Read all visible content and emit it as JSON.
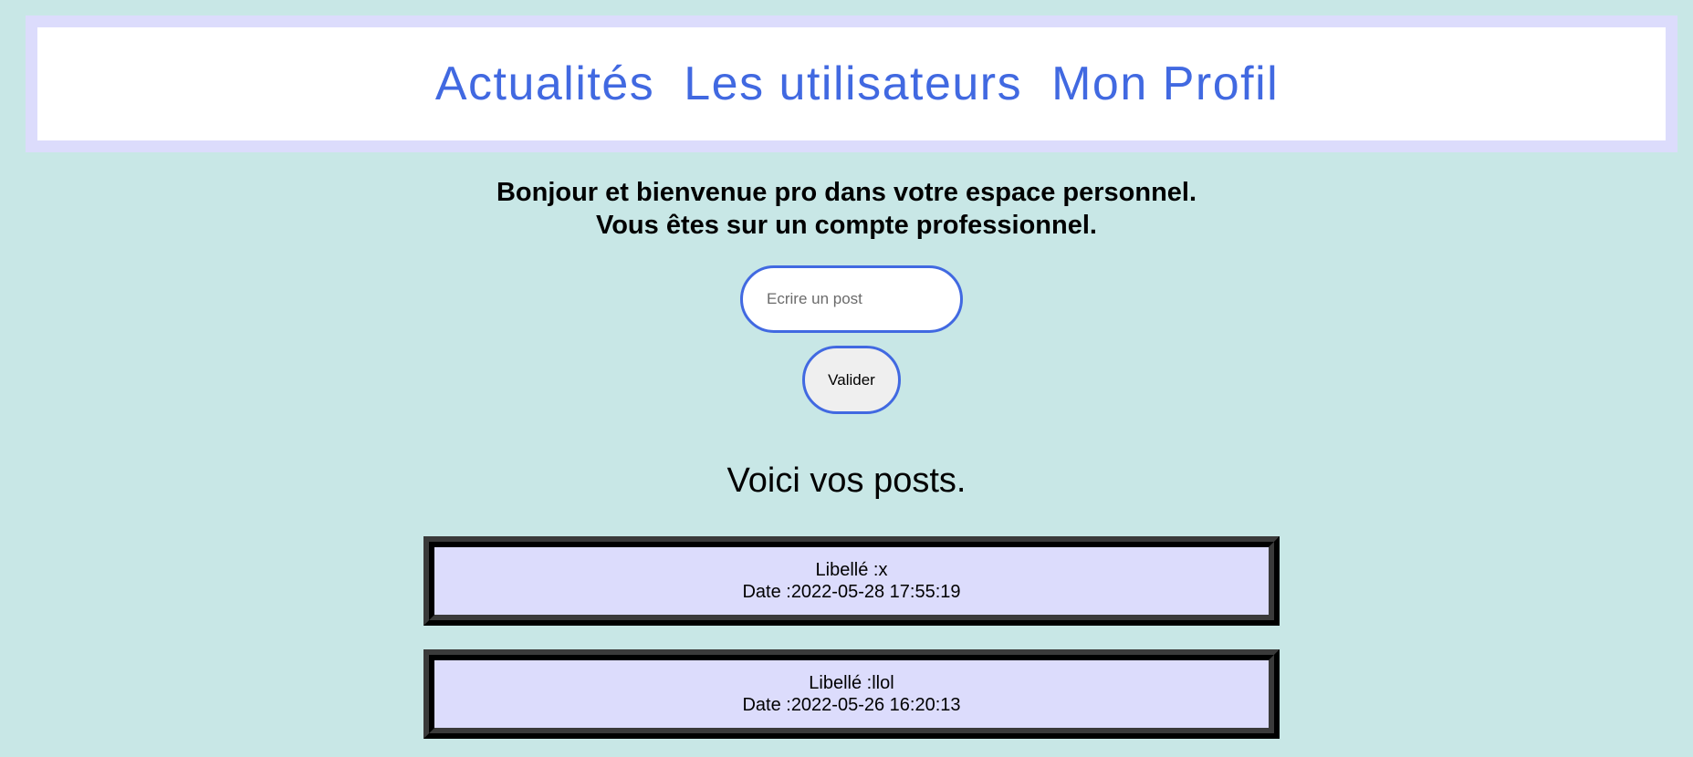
{
  "nav": {
    "items": [
      {
        "label": "Actualités"
      },
      {
        "label": "Les utilisateurs"
      },
      {
        "label": "Mon Profil"
      }
    ]
  },
  "welcome": {
    "line1": "Bonjour et bienvenue pro dans votre espace personnel.",
    "line2": "Vous êtes sur un compte professionnel."
  },
  "post_form": {
    "input_value": "",
    "input_placeholder": "Ecrire un post",
    "submit_label": "Valider"
  },
  "posts_section": {
    "title": "Voici vos posts.",
    "label_prefix": "Libellé : ",
    "date_prefix": "Date :"
  },
  "posts": [
    {
      "label": "x",
      "date": "2022-05-28 17:55:19"
    },
    {
      "label": "llol",
      "date": "2022-05-26 16:20:13"
    }
  ],
  "colors": {
    "page_background": "#c8e7e6",
    "nav_frame": "#dcdcfc",
    "accent": "#4169e1",
    "card_background": "#dcdcfc",
    "card_border": "#3a3a3a"
  }
}
